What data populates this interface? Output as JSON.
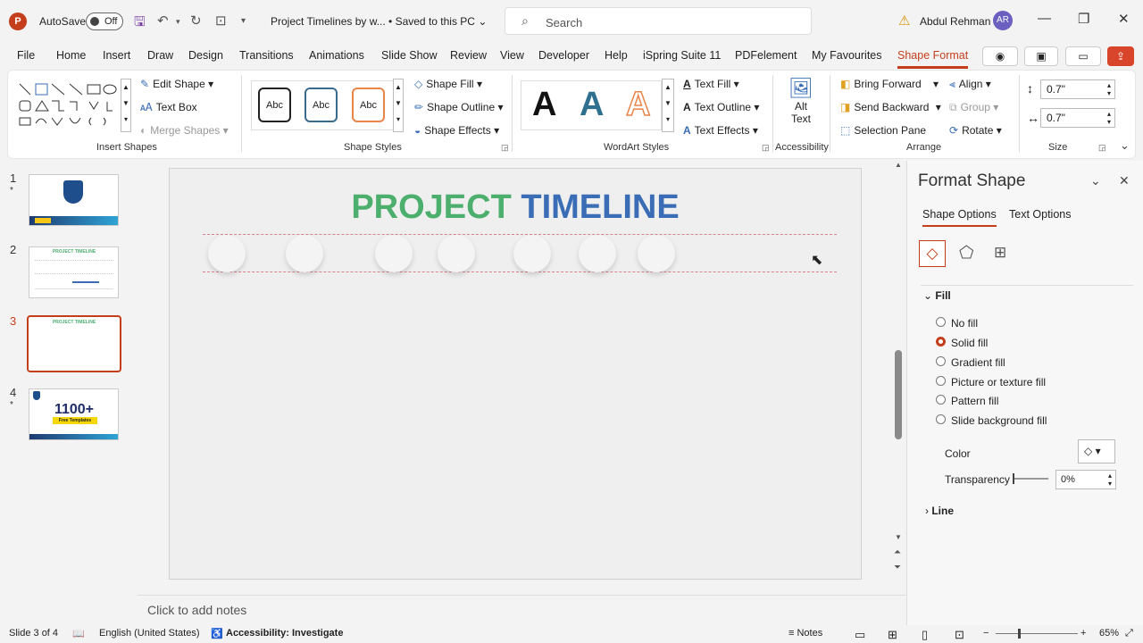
{
  "titlebar": {
    "app_icon": "P",
    "autosave_label": "AutoSave",
    "autosave_state": "Off",
    "doc_title": "Project Timelines by w...  •  Saved to this PC",
    "search_placeholder": "Search",
    "user_name": "Abdul Rehman",
    "user_initials": "AR"
  },
  "tabs": [
    "File",
    "Home",
    "Insert",
    "Draw",
    "Design",
    "Transitions",
    "Animations",
    "Slide Show",
    "Review",
    "View",
    "Developer",
    "Help",
    "iSpring Suite 11",
    "PDFelement",
    "My Favourites",
    "Shape Format"
  ],
  "ribbon": {
    "insert_shapes": {
      "label": "Insert Shapes",
      "edit_shape": "Edit Shape",
      "text_box": "Text Box",
      "merge_shapes": "Merge Shapes"
    },
    "shape_styles": {
      "label": "Shape Styles",
      "sample": "Abc",
      "shape_fill": "Shape Fill",
      "shape_outline": "Shape Outline",
      "shape_effects": "Shape Effects"
    },
    "wordart": {
      "label": "WordArt Styles",
      "letter": "A",
      "text_fill": "Text Fill",
      "text_outline": "Text Outline",
      "text_effects": "Text Effects"
    },
    "accessibility": {
      "label": "Accessibility",
      "alt_text_1": "Alt",
      "alt_text_2": "Text"
    },
    "arrange": {
      "label": "Arrange",
      "bring_forward": "Bring Forward",
      "send_backward": "Send Backward",
      "selection_pane": "Selection Pane",
      "align": "Align",
      "group": "Group",
      "rotate": "Rotate"
    },
    "size": {
      "label": "Size",
      "height": "0.7\"",
      "width": "0.7\""
    }
  },
  "slides": [
    {
      "num": "1",
      "star": "*"
    },
    {
      "num": "2",
      "star": ""
    },
    {
      "num": "3",
      "star": ""
    },
    {
      "num": "4",
      "star": "*"
    }
  ],
  "thumbs": {
    "t2_title": "PROJECT TIMELINE",
    "t3_title": "PROJECT TIMELINE",
    "t4_big": "1100+",
    "t4_sub": "Free Templates"
  },
  "slide": {
    "title_part1": "PROJECT",
    "title_part2": "TIMELINE",
    "color1": "#4caf6e",
    "color2": "#3a6db5"
  },
  "notes_placeholder": "Click to add notes",
  "format_pane": {
    "title": "Format Shape",
    "tab_shape": "Shape Options",
    "tab_text": "Text Options",
    "fill_header": "Fill",
    "options": [
      "No fill",
      "Solid fill",
      "Gradient fill",
      "Picture or texture fill",
      "Pattern fill",
      "Slide background fill"
    ],
    "selected": "Solid fill",
    "color_label": "Color",
    "transparency_label": "Transparency",
    "transparency_value": "0%",
    "line_header": "Line"
  },
  "status": {
    "slide_info": "Slide 3 of 4",
    "language": "English (United States)",
    "accessibility": "Accessibility: Investigate",
    "notes": "Notes",
    "zoom": "65%"
  }
}
